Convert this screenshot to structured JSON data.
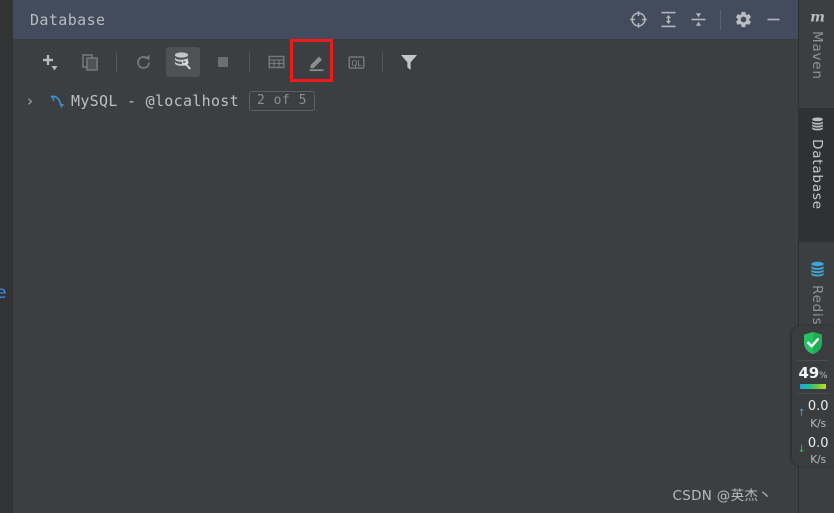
{
  "window": {
    "title": "Database",
    "header_actions": [
      {
        "name": "scroll-from-source-icon",
        "label": "Scroll from Source"
      },
      {
        "name": "expand-all-icon",
        "label": "Expand All"
      },
      {
        "name": "collapse-all-icon",
        "label": "Collapse All"
      },
      {
        "name": "settings-gear-icon",
        "label": "Options"
      },
      {
        "name": "minimize-icon",
        "label": "Hide"
      }
    ]
  },
  "toolbar": {
    "items": [
      {
        "name": "add-new-button",
        "label": "New",
        "state": "enabled"
      },
      {
        "name": "duplicate-button",
        "label": "Duplicate",
        "state": "disabled"
      },
      {
        "name": "refresh-button",
        "label": "Refresh",
        "state": "disabled"
      },
      {
        "name": "data-source-properties-button",
        "label": "Data Source Properties",
        "state": "selected"
      },
      {
        "name": "stop-button",
        "label": "Stop",
        "state": "disabled"
      },
      {
        "name": "jump-to-table-button",
        "label": "Jump to Query Console",
        "state": "disabled"
      },
      {
        "name": "modify-button",
        "label": "Modify",
        "state": "disabled"
      },
      {
        "name": "query-console-button",
        "label": "Open Console",
        "state": "disabled"
      },
      {
        "name": "filter-button",
        "label": "Filter",
        "state": "enabled"
      }
    ],
    "highlight": {
      "target": "data-source-properties-button",
      "color": "#ef1b1b"
    }
  },
  "tree": {
    "rows": [
      {
        "chevron": "›",
        "icon": "mysql-dolphin-icon",
        "label": "MySQL - @localhost",
        "badge": "2 of 5"
      }
    ]
  },
  "stripe": {
    "buttons": [
      {
        "name": "sidebar-item-maven",
        "label": "Maven",
        "icon": "maven-icon",
        "active": false
      },
      {
        "name": "sidebar-item-database",
        "label": "Database",
        "icon": "database-cylinder-icon",
        "active": true
      },
      {
        "name": "sidebar-item-redis-helper",
        "label": "Redis Helper",
        "icon": "redis-cylinder-icon",
        "active": false
      }
    ]
  },
  "monitor_widget": {
    "shield_icon": "security-shield-check-icon",
    "cpu_value": "49",
    "cpu_unit": "%",
    "upload": {
      "arrow": "↑",
      "value": "0.0",
      "unit": "K/s",
      "color": "#3b9fe3"
    },
    "download": {
      "arrow": "↓",
      "value": "0.0",
      "unit": "K/s",
      "color": "#2fbd63"
    }
  },
  "watermark": {
    "text": "CSDN @英杰丶"
  },
  "left_gutter": {
    "glyph": "e"
  },
  "colors": {
    "header_bg": "#434c5c",
    "panel_bg": "#3c3f41",
    "stripe_active_bg": "#2f3133",
    "highlight": "#ef1b1b",
    "text": "#bcc0c3"
  }
}
